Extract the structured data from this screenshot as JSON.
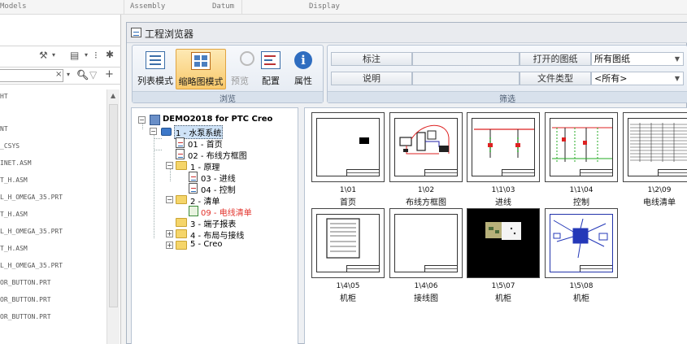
{
  "top_strip": {
    "models": "Models",
    "assembly": "Assembly",
    "datum": "Datum",
    "display": "Display"
  },
  "left_panel": {
    "items": [
      "HT",
      "NT",
      "_CSYS",
      "INET.ASM",
      "T_H.ASM",
      "L_H_OMEGA_35.PRT",
      "T_H.ASM",
      "L_H_OMEGA_35.PRT",
      "T_H.ASM",
      "L_H_OMEGA_35.PRT",
      "OR_BUTTON.PRT",
      "OR_BUTTON.PRT",
      "OR_BUTTON.PRT"
    ]
  },
  "window": {
    "title": "工程浏览器"
  },
  "ribbon": {
    "browse_group_label": "浏览",
    "filter_group_label": "筛选",
    "buttons": {
      "list_mode": "列表模式",
      "thumb_mode": "缩略图模式",
      "preview": "预览",
      "config": "配置",
      "properties": "属性"
    },
    "filter": {
      "label_tag": "标注",
      "label_tag_value": "",
      "label_desc": "说明",
      "label_desc_value": "",
      "open_sheet_label": "打开的图纸",
      "open_sheet_value": "所有图纸",
      "file_type_label": "文件类型",
      "file_type_value": "<所有>"
    }
  },
  "tree": {
    "root": "DEMO2018 for PTC Creo",
    "nodes": [
      {
        "label": "1 - 水泵系统"
      },
      {
        "label": "01 - 首页"
      },
      {
        "label": "02 - 布线方框图"
      },
      {
        "label": "1 - 原理"
      },
      {
        "label": "03 - 进线"
      },
      {
        "label": "04 - 控制"
      },
      {
        "label": "2 - 清单"
      },
      {
        "label": "09 - 电线清单"
      },
      {
        "label": "3 - 端子报表"
      },
      {
        "label": "4 - 布局与接线"
      },
      {
        "label": "5 - Creo"
      }
    ]
  },
  "thumbnails": [
    {
      "code": "1\\01",
      "name": "首页"
    },
    {
      "code": "1\\02",
      "name": "布线方框图"
    },
    {
      "code": "1\\1\\03",
      "name": "进线"
    },
    {
      "code": "1\\1\\04",
      "name": "控制"
    },
    {
      "code": "1\\2\\09",
      "name": "电线清单"
    },
    {
      "code": "1\\4\\05",
      "name": "机柜"
    },
    {
      "code": "1\\4\\06",
      "name": "接线图"
    },
    {
      "code": "1\\5\\07",
      "name": "机柜"
    },
    {
      "code": "1\\5\\08",
      "name": "机柜"
    }
  ],
  "colors": {
    "accent": "#3b6ea8",
    "selected_button": "#f9c96b",
    "highlight_text": "#e2322b"
  }
}
